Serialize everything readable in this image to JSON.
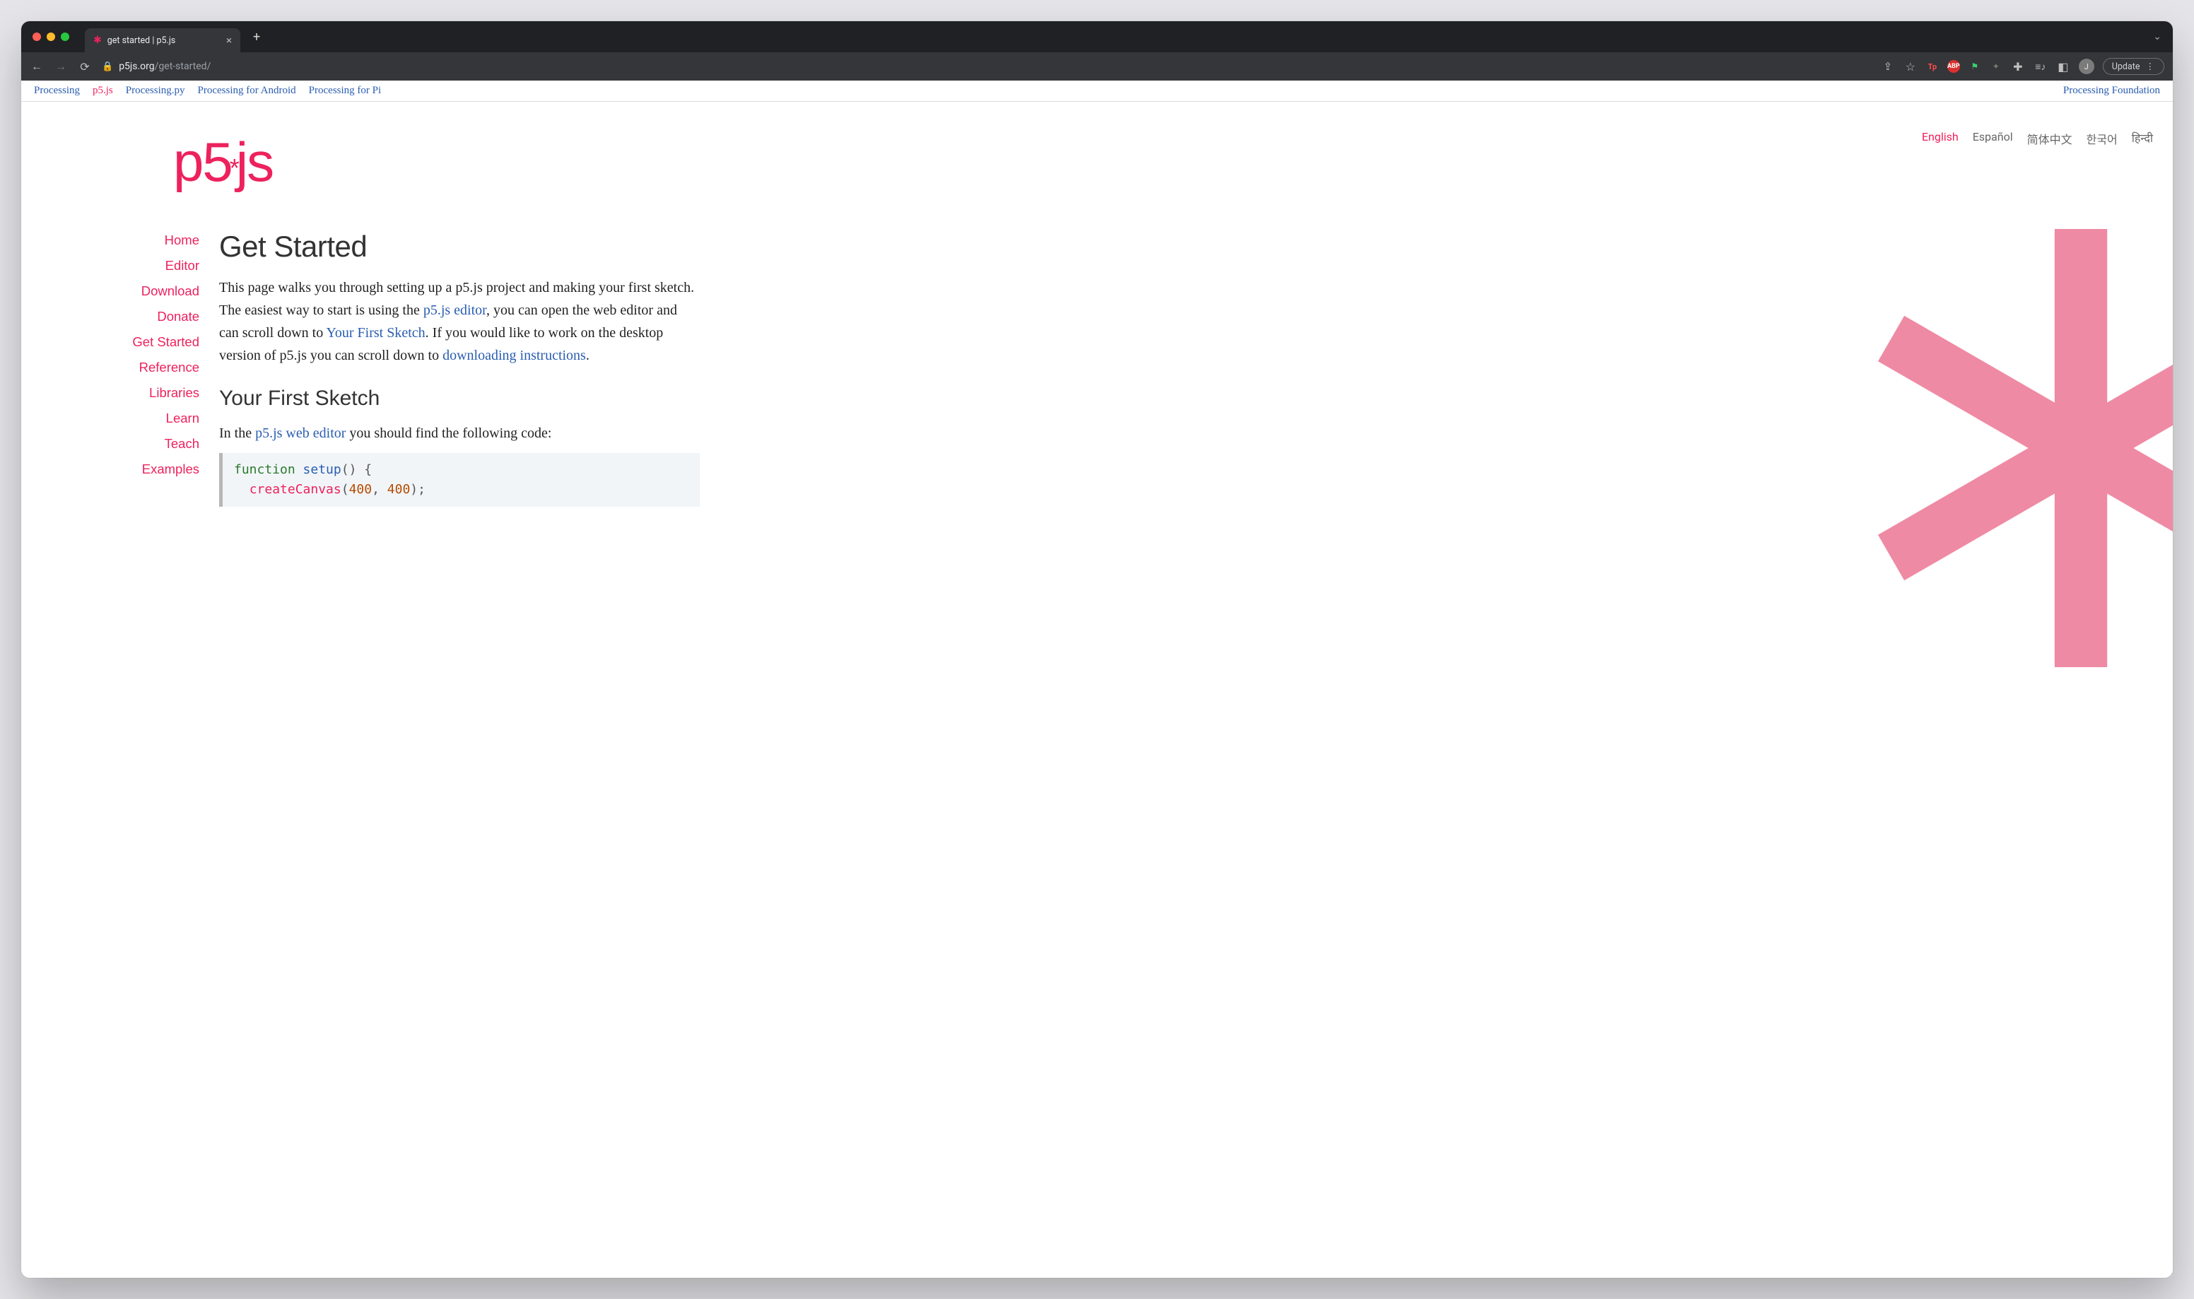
{
  "browser": {
    "tab_title": "get started | p5.js",
    "url_domain": "p5js.org",
    "url_path": "/get-started/",
    "update_label": "Update",
    "avatar_initial": "J",
    "ext_tp": "Tp",
    "ext_abp": "ABP"
  },
  "family_bar": {
    "items": [
      {
        "label": "Processing",
        "active": false
      },
      {
        "label": "p5.js",
        "active": true
      },
      {
        "label": "Processing.py",
        "active": false
      },
      {
        "label": "Processing for Android",
        "active": false
      },
      {
        "label": "Processing for Pi",
        "active": false
      }
    ],
    "right_label": "Processing Foundation"
  },
  "languages": [
    {
      "label": "English",
      "active": true
    },
    {
      "label": "Español",
      "active": false
    },
    {
      "label": "简体中文",
      "active": false
    },
    {
      "label": "한국어",
      "active": false
    },
    {
      "label": "हिन्दी",
      "active": false
    }
  ],
  "logo": {
    "p5": "p5",
    "ast": "*",
    "js": "js"
  },
  "sidenav": [
    "Home",
    "Editor",
    "Download",
    "Donate",
    "Get Started",
    "Reference",
    "Libraries",
    "Learn",
    "Teach",
    "Examples"
  ],
  "main": {
    "h1": "Get Started",
    "p1_a": "This page walks you through setting up a p5.js project and making your first sketch. The easiest way to start is using the ",
    "p1_link1": "p5.js editor",
    "p1_b": ", you can open the web editor and can scroll down to ",
    "p1_link2": "Your First Sketch",
    "p1_c": ". If you would like to work on the desktop version of p5.js you can scroll down to ",
    "p1_link3": "downloading instructions",
    "p1_d": ".",
    "h2": "Your First Sketch",
    "p2_a": "In the ",
    "p2_link1": "p5.js web editor",
    "p2_b": " you should find the following code:"
  },
  "code": {
    "kw_function": "function",
    "fn_setup": "setup",
    "paren_open": "()",
    "brace_open": " {",
    "call_createCanvas": "createCanvas",
    "args_open": "(",
    "num1": "400",
    "comma": ", ",
    "num2": "400",
    "args_close": ");"
  }
}
